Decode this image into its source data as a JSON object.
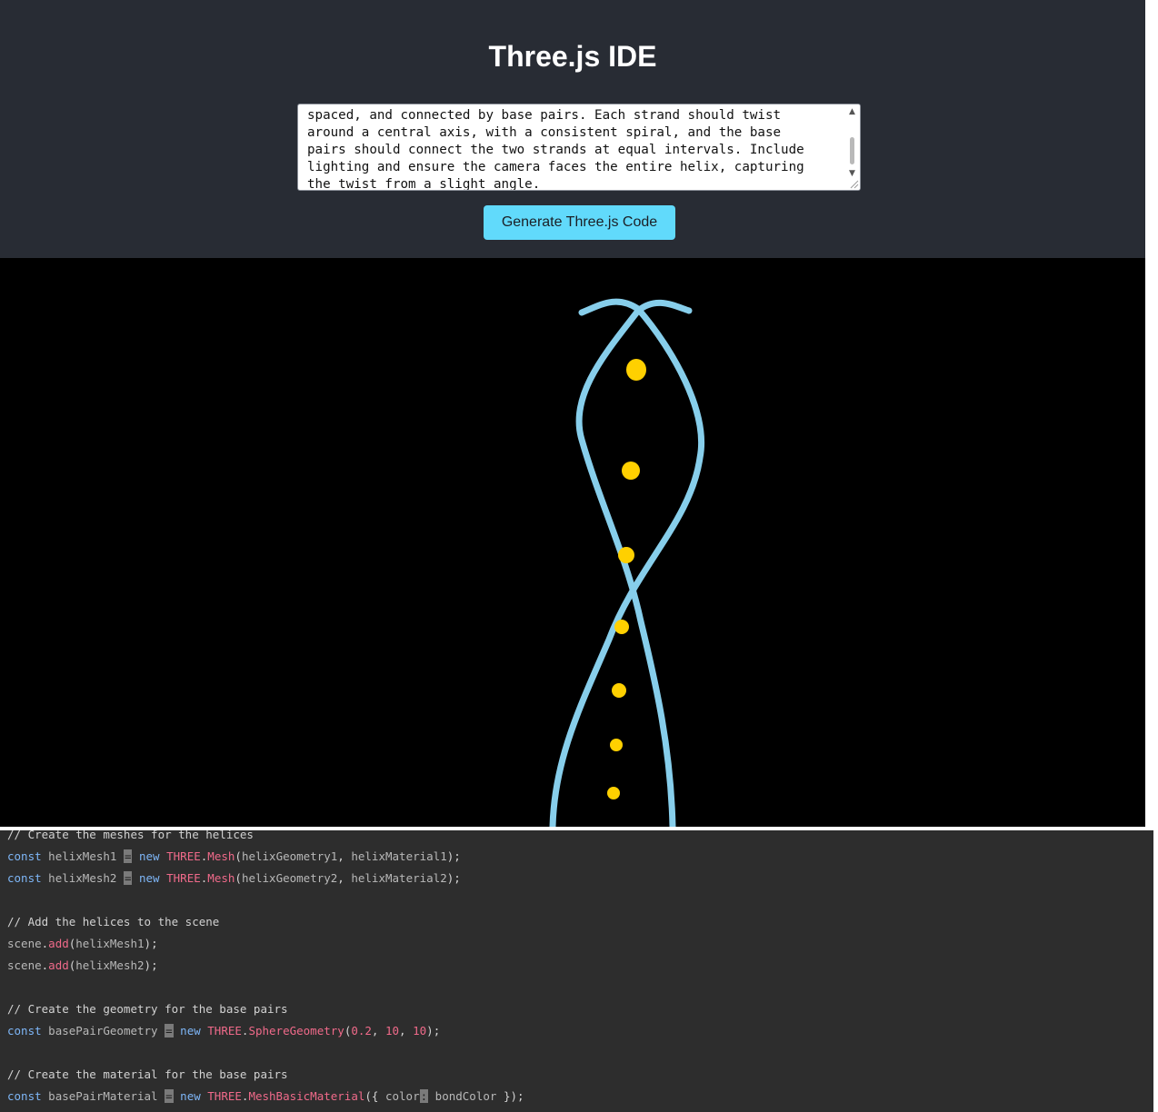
{
  "app": {
    "title": "Three.js IDE"
  },
  "prompt": {
    "visible_lines": [
      "spaced, and connected by base pairs. Each strand should twist",
      "around a central axis, with a consistent spiral, and the base",
      "pairs should connect the two strands at equal intervals. Include",
      "lighting and ensure the camera faces the entire helix, capturing",
      "the twist from a slight angle."
    ]
  },
  "generate_button": {
    "label": "Generate Three.js Code"
  },
  "scene": {
    "background_color": "#000000",
    "strand_color": "#87ceeb",
    "base_pair_color": "#ffd000",
    "strand_count": 2,
    "visible_base_pairs": 7
  },
  "editor": {
    "lines": [
      [
        [
          "comment",
          "// Create the meshes for the helices"
        ]
      ],
      [
        [
          "keyword",
          "const"
        ],
        [
          "ident",
          " helixMesh1 "
        ],
        [
          "op",
          "="
        ],
        [
          "keyword",
          " new "
        ],
        [
          "class",
          "THREE"
        ],
        [
          "punct",
          "."
        ],
        [
          "method",
          "Mesh"
        ],
        [
          "punct",
          "("
        ],
        [
          "ident",
          "helixGeometry1"
        ],
        [
          "punct",
          ", "
        ],
        [
          "ident",
          "helixMaterial1"
        ],
        [
          "punct",
          ");"
        ]
      ],
      [
        [
          "keyword",
          "const"
        ],
        [
          "ident",
          " helixMesh2 "
        ],
        [
          "op",
          "="
        ],
        [
          "keyword",
          " new "
        ],
        [
          "class",
          "THREE"
        ],
        [
          "punct",
          "."
        ],
        [
          "method",
          "Mesh"
        ],
        [
          "punct",
          "("
        ],
        [
          "ident",
          "helixGeometry2"
        ],
        [
          "punct",
          ", "
        ],
        [
          "ident",
          "helixMaterial2"
        ],
        [
          "punct",
          ");"
        ]
      ],
      [],
      [
        [
          "comment",
          "// Add the helices to the scene"
        ]
      ],
      [
        [
          "ident",
          "scene"
        ],
        [
          "punct",
          "."
        ],
        [
          "method",
          "add"
        ],
        [
          "punct",
          "("
        ],
        [
          "ident",
          "helixMesh1"
        ],
        [
          "punct",
          ");"
        ]
      ],
      [
        [
          "ident",
          "scene"
        ],
        [
          "punct",
          "."
        ],
        [
          "method",
          "add"
        ],
        [
          "punct",
          "("
        ],
        [
          "ident",
          "helixMesh2"
        ],
        [
          "punct",
          ");"
        ]
      ],
      [],
      [
        [
          "comment",
          "// Create the geometry for the base pairs"
        ]
      ],
      [
        [
          "keyword",
          "const"
        ],
        [
          "ident",
          " basePairGeometry "
        ],
        [
          "op",
          "="
        ],
        [
          "keyword",
          " new "
        ],
        [
          "class",
          "THREE"
        ],
        [
          "punct",
          "."
        ],
        [
          "method",
          "SphereGeometry"
        ],
        [
          "punct",
          "("
        ],
        [
          "number",
          "0.2"
        ],
        [
          "punct",
          ", "
        ],
        [
          "number",
          "10"
        ],
        [
          "punct",
          ", "
        ],
        [
          "number",
          "10"
        ],
        [
          "punct",
          ");"
        ]
      ],
      [],
      [
        [
          "comment",
          "// Create the material for the base pairs"
        ]
      ],
      [
        [
          "keyword",
          "const"
        ],
        [
          "ident",
          " basePairMaterial "
        ],
        [
          "op",
          "="
        ],
        [
          "keyword",
          " new "
        ],
        [
          "class",
          "THREE"
        ],
        [
          "punct",
          "."
        ],
        [
          "method",
          "MeshBasicMaterial"
        ],
        [
          "punct",
          "({ "
        ],
        [
          "ident",
          "color"
        ],
        [
          "op",
          ":"
        ],
        [
          "ident",
          " bondColor "
        ],
        [
          "punct",
          "});"
        ]
      ]
    ]
  }
}
